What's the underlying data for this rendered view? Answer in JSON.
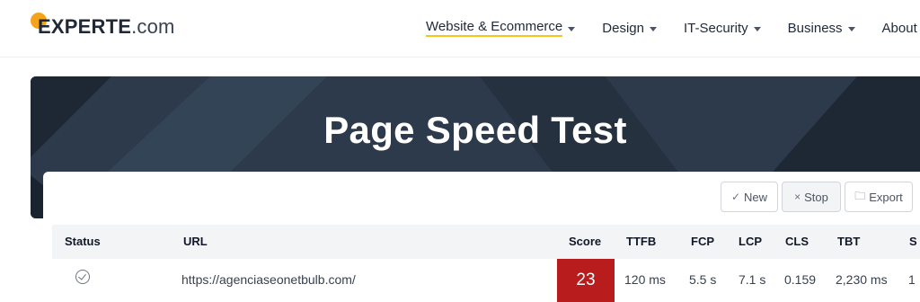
{
  "header": {
    "logo_main": "EXPERTE",
    "logo_suffix": ".com",
    "nav": [
      {
        "label": "Website & Ecommerce"
      },
      {
        "label": "Design"
      },
      {
        "label": "IT-Security"
      },
      {
        "label": "Business"
      },
      {
        "label": "About"
      }
    ]
  },
  "hero": {
    "title": "Page Speed Test"
  },
  "toolbar": {
    "new_label": "New",
    "stop_label": "Stop",
    "export_label": "Export"
  },
  "table": {
    "columns": [
      "Status",
      "URL",
      "Score",
      "TTFB",
      "FCP",
      "LCP",
      "CLS",
      "TBT",
      "S"
    ],
    "rows": [
      {
        "url": "https://agenciaseonetbulb.com/",
        "score": "23",
        "ttfb": "120 ms",
        "fcp": "5.5 s",
        "lcp": "7.1 s",
        "cls": "0.159",
        "tbt": "2,230 ms",
        "s": "1"
      }
    ]
  },
  "colors": {
    "accent": "#f5a31a",
    "hero_bg": "#2c3a4b",
    "score_bad": "#b91c1c"
  }
}
